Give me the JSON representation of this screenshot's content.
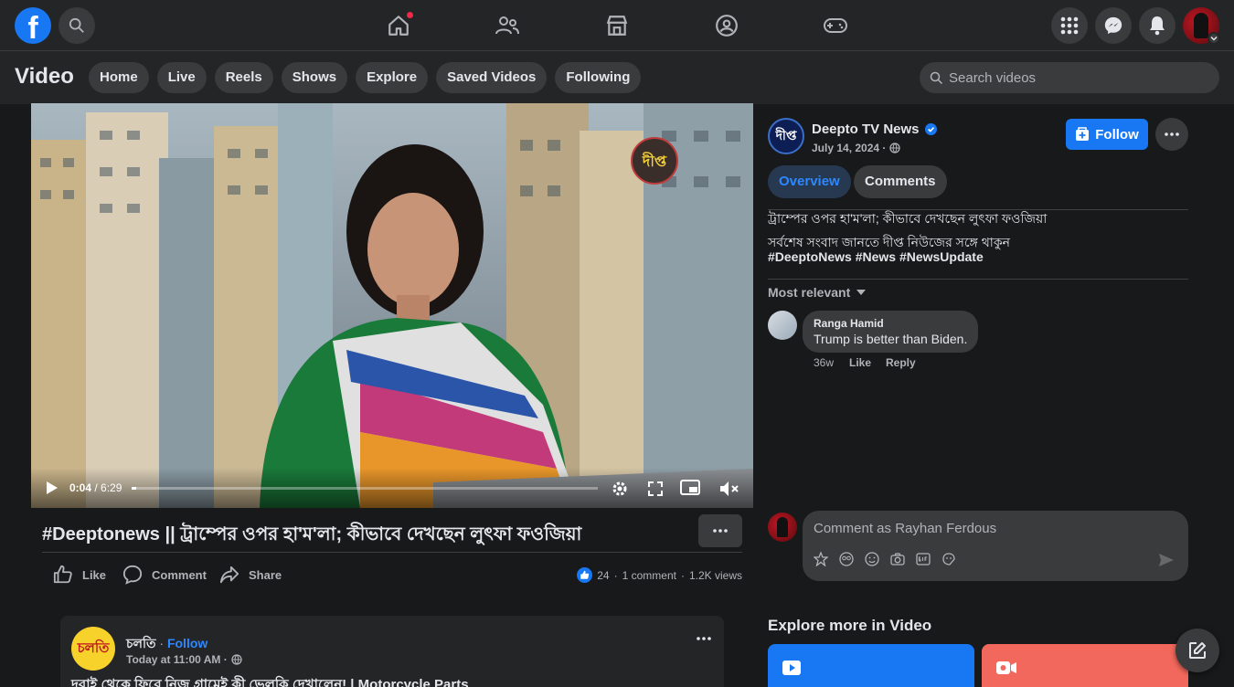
{
  "nav": {
    "logo_letter": "f",
    "home_notification": true
  },
  "subheader": {
    "title": "Video",
    "tabs": [
      "Home",
      "Live",
      "Reels",
      "Shows",
      "Explore",
      "Saved Videos",
      "Following"
    ],
    "search_placeholder": "Search videos"
  },
  "player": {
    "current_time": "0:04",
    "duration": "6:29",
    "progress_fraction": 0.01,
    "watermark": "দীপ্ত"
  },
  "video": {
    "title": "#Deeptonews || ট্রাম্পের ওপর হা'ম'লা; কীভাবে দেখছেন লুৎফা ফওজিয়া",
    "like_label": "Like",
    "comment_label": "Comment",
    "share_label": "Share",
    "reactions_count": "24",
    "comments_count": "1 comment",
    "views": "1.2K views"
  },
  "page": {
    "name": "Deepto TV News",
    "avatar_text": "দীপ্ত",
    "date": "July 14, 2024 ·",
    "follow_label": "Follow",
    "tabs": [
      "Overview",
      "Comments"
    ],
    "description_line1": "ট্রাম্পের ওপর হা'ম'লা; কীভাবে দেখছেন লুৎফা ফওজিয়া",
    "description_line2": "সর্বশেষ সংবাদ জানতে দীপ্ত নিউজের সঙ্গে থাকুন",
    "hashtags": "#DeeptoNews #News #NewsUpdate"
  },
  "comments": {
    "sort_label": "Most relevant",
    "items": [
      {
        "author": "Ranga Hamid",
        "text": "Trump is better than Biden.",
        "age": "36w",
        "like": "Like",
        "reply": "Reply"
      }
    ],
    "compose_placeholder": "Comment as Rayhan Ferdous"
  },
  "next_post": {
    "page_name": "চলতি",
    "follow_label": "Follow",
    "avatar_text": "চলতি",
    "time": "Today at 11:00 AM ·",
    "title": "দুবাই থেকে ফিরে নিজ গ্রামেই কী ভেলকি দেখালেন! | Motorcycle Parts"
  },
  "explore": {
    "heading": "Explore more in Video"
  },
  "colors": {
    "accent": "#1877f2",
    "background": "#18191a",
    "surface": "#242526"
  }
}
